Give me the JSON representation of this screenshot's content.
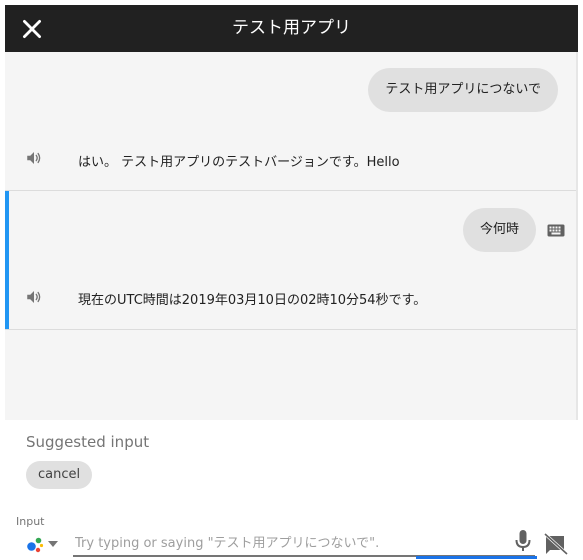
{
  "header": {
    "title": "テスト用アプリ",
    "close_icon": "close-icon"
  },
  "conversation": [
    {
      "user": "テスト用アプリにつないで",
      "assistant": "はい。 テスト用アプリのテストバージョンです。Hello",
      "speaker_icon": "speaker-icon"
    },
    {
      "user": "今何時",
      "assistant": "現在のUTC時間は2019年03月10日の02時10分54秒です。",
      "speaker_icon": "speaker-icon",
      "input_icon": "keyboard-icon",
      "active": true
    }
  ],
  "suggestions": {
    "title": "Suggested input",
    "chips": [
      "cancel"
    ]
  },
  "input": {
    "label": "Input",
    "placeholder": "Try typing or saying \"テスト用アプリにつないで\".",
    "value": "",
    "icons": [
      "google-assistant-icon",
      "chevron-down-icon",
      "microphone-icon",
      "send-disabled-icon"
    ]
  },
  "colors": {
    "header_bg": "#212121",
    "chat_bg": "#f5f5f5",
    "bubble_bg": "#e0e0e0",
    "accent": "#2196f3",
    "input_progress": "#1a73e8"
  }
}
